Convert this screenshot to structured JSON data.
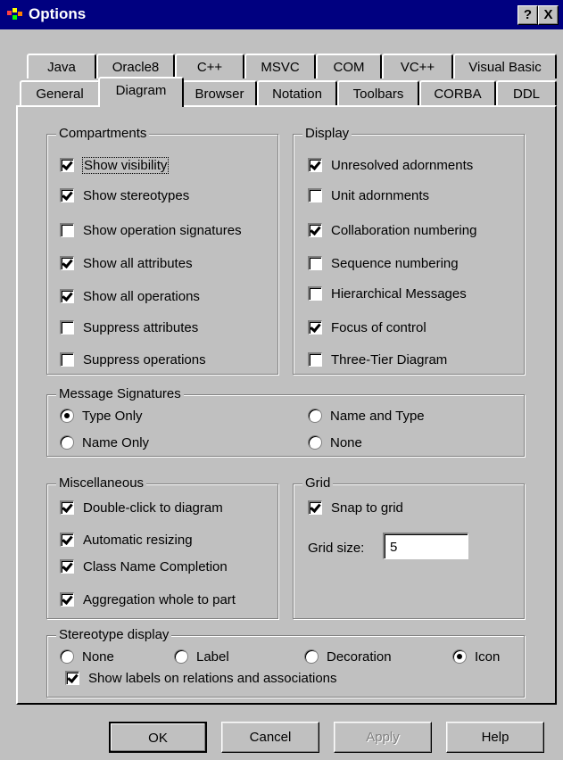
{
  "window": {
    "title": "Options",
    "help_btn": "?",
    "close_btn": "X"
  },
  "tabs_back": [
    "Java",
    "Oracle8",
    "C++",
    "MSVC",
    "COM",
    "VC++",
    "Visual Basic"
  ],
  "tabs_front": [
    "General",
    "Diagram",
    "Browser",
    "Notation",
    "Toolbars",
    "CORBA",
    "DDL"
  ],
  "active_tab": "Diagram",
  "compartments": {
    "legend": "Compartments",
    "items": [
      {
        "label": "Show visibility",
        "checked": true
      },
      {
        "label": "Show stereotypes",
        "checked": true
      },
      {
        "label": "Show operation signatures",
        "checked": false
      },
      {
        "label": "Show all attributes",
        "checked": true
      },
      {
        "label": "Show all operations",
        "checked": true
      },
      {
        "label": "Suppress attributes",
        "checked": false
      },
      {
        "label": "Suppress operations",
        "checked": false
      }
    ]
  },
  "display": {
    "legend": "Display",
    "items": [
      {
        "label": "Unresolved adornments",
        "checked": true
      },
      {
        "label": "Unit adornments",
        "checked": false
      },
      {
        "label": "Collaboration numbering",
        "checked": true
      },
      {
        "label": "Sequence numbering",
        "checked": false
      },
      {
        "label": "Hierarchical Messages",
        "checked": false
      },
      {
        "label": "Focus of control",
        "checked": true
      },
      {
        "label": "Three-Tier Diagram",
        "checked": false
      }
    ]
  },
  "message_signatures": {
    "legend": "Message Signatures",
    "options": [
      {
        "label": "Type Only",
        "selected": true
      },
      {
        "label": "Name and Type",
        "selected": false
      },
      {
        "label": "Name Only",
        "selected": false
      },
      {
        "label": "None",
        "selected": false
      }
    ]
  },
  "miscellaneous": {
    "legend": "Miscellaneous",
    "items": [
      {
        "label": "Double-click to diagram",
        "checked": true
      },
      {
        "label": "Automatic resizing",
        "checked": true
      },
      {
        "label": "Class Name Completion",
        "checked": true
      },
      {
        "label": "Aggregation whole to part",
        "checked": true
      }
    ]
  },
  "grid": {
    "legend": "Grid",
    "snap_label": "Snap to grid",
    "snap_checked": true,
    "size_label": "Grid size:",
    "size_value": "5"
  },
  "stereotype_display": {
    "legend": "Stereotype display",
    "options": [
      {
        "label": "None",
        "selected": false
      },
      {
        "label": "Label",
        "selected": false
      },
      {
        "label": "Decoration",
        "selected": false
      },
      {
        "label": "Icon",
        "selected": true
      }
    ],
    "show_labels": {
      "label": "Show labels on relations and associations",
      "checked": true
    }
  },
  "buttons": {
    "ok": "OK",
    "cancel": "Cancel",
    "apply": "Apply",
    "help": "Help"
  },
  "colors": {
    "titlebar": "#000080",
    "face": "#c0c0c0"
  }
}
